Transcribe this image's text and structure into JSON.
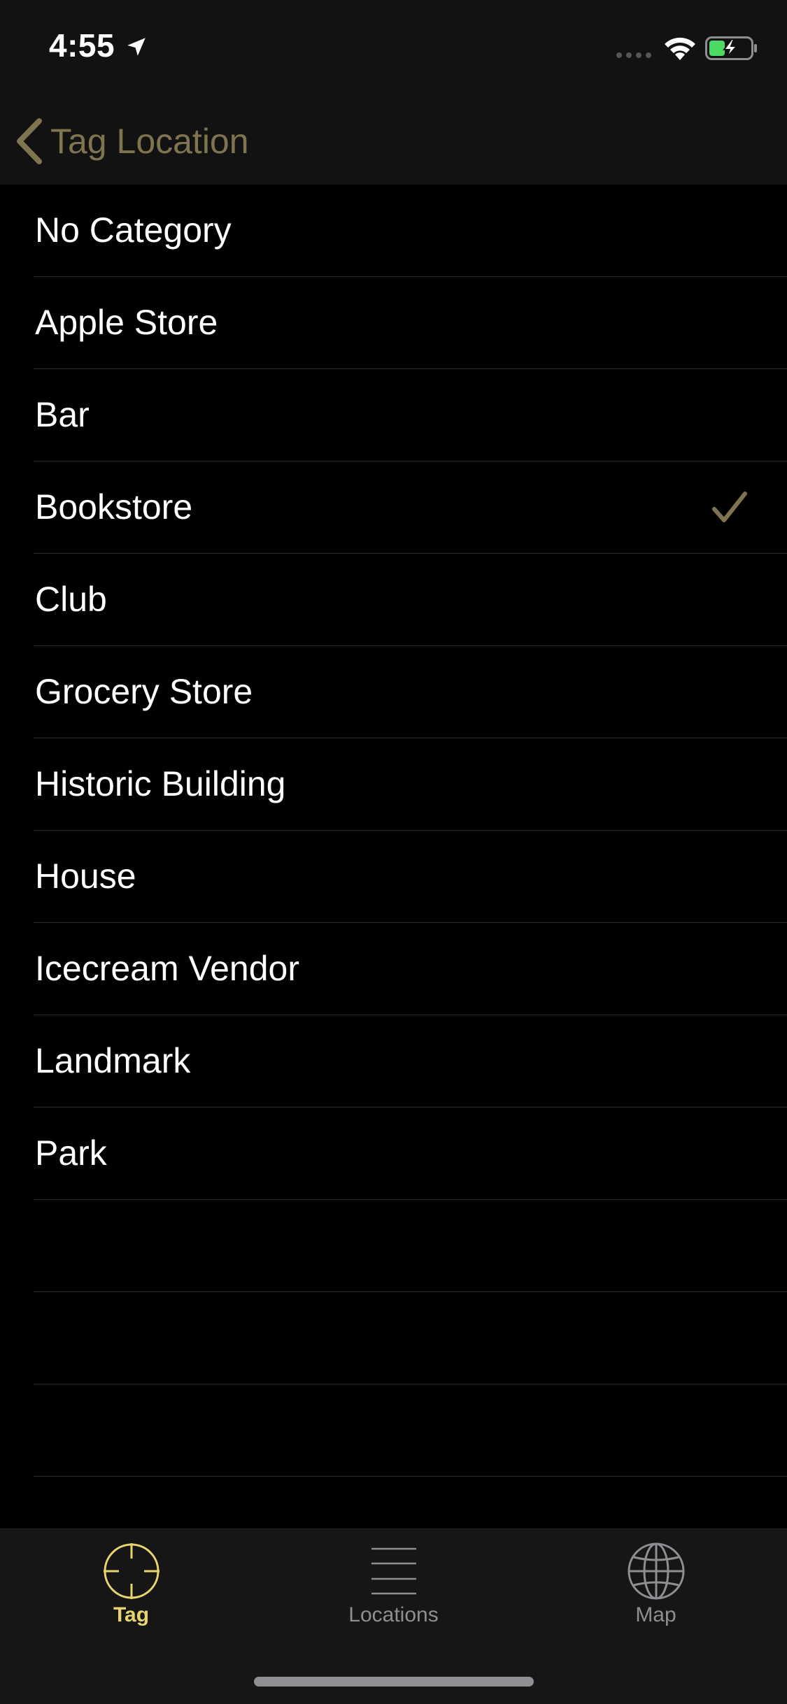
{
  "status_bar": {
    "time": "4:55",
    "battery_color": "#4cd964"
  },
  "nav": {
    "back_label": "Tag Location",
    "accent_color": "#7e744f"
  },
  "categories": [
    {
      "label": "No Category",
      "selected": false
    },
    {
      "label": "Apple Store",
      "selected": false
    },
    {
      "label": "Bar",
      "selected": false
    },
    {
      "label": "Bookstore",
      "selected": true
    },
    {
      "label": "Club",
      "selected": false
    },
    {
      "label": "Grocery Store",
      "selected": false
    },
    {
      "label": "Historic Building",
      "selected": false
    },
    {
      "label": "House",
      "selected": false
    },
    {
      "label": "Icecream Vendor",
      "selected": false
    },
    {
      "label": "Landmark",
      "selected": false
    },
    {
      "label": "Park",
      "selected": false
    },
    {
      "label": "",
      "selected": false
    },
    {
      "label": "",
      "selected": false
    },
    {
      "label": "",
      "selected": false
    }
  ],
  "tabbar": {
    "tabs": [
      {
        "label": "Tag",
        "icon": "crosshair-icon",
        "active": true
      },
      {
        "label": "Locations",
        "icon": "list-lines-icon",
        "active": false
      },
      {
        "label": "Map",
        "icon": "globe-icon",
        "active": false
      }
    ],
    "active_color": "#e7d46e",
    "inactive_color": "#8e8e93"
  }
}
